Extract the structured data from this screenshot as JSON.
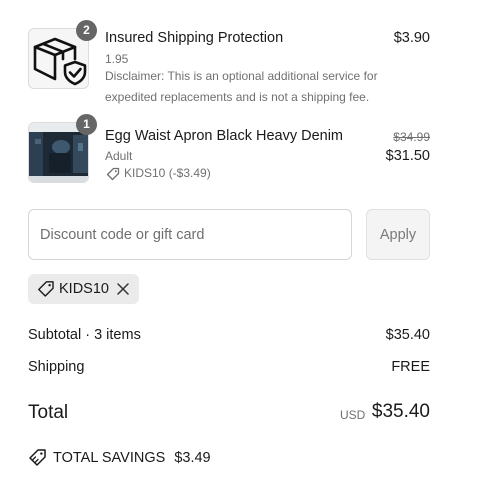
{
  "items": [
    {
      "title": "Insured Shipping Protection",
      "variant": "1.95",
      "note": "Disclaimer: This is an optional additional service for expedited replacements and is not a shipping fee.",
      "price": "$3.90",
      "quantity": "2",
      "icon": "box-shield-icon"
    },
    {
      "title": "Egg Waist Apron Black Heavy Denim",
      "variant": "Adult",
      "discount": "KIDS10 (-$3.49)",
      "original_price": "$34.99",
      "price": "$31.50",
      "quantity": "1",
      "icon": "tag-icon"
    }
  ],
  "discount": {
    "placeholder": "Discount code or gift card",
    "apply_label": "Apply",
    "applied_code": "KIDS10"
  },
  "summary": {
    "subtotal_label": "Subtotal · 3 items",
    "subtotal_value": "$35.40",
    "shipping_label": "Shipping",
    "shipping_value": "FREE",
    "total_label": "Total",
    "currency": "USD",
    "total_value": "$35.40",
    "savings_label": "TOTAL SAVINGS",
    "savings_value": "$3.49"
  },
  "colors": {
    "badge": "#666666",
    "muted_text": "#707070",
    "chip_bg": "#ebebeb"
  }
}
